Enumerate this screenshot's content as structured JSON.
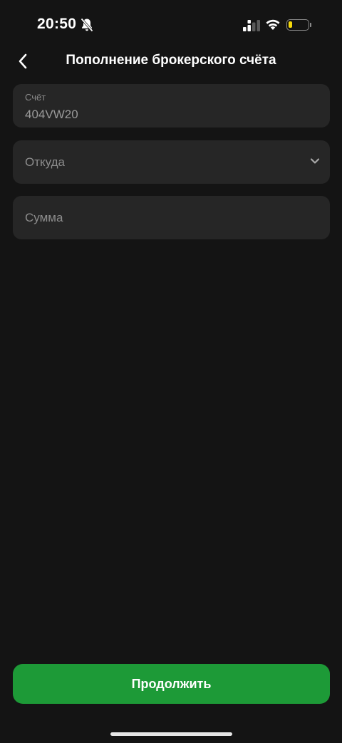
{
  "status_bar": {
    "time": "20:50",
    "icons": [
      "bell-slash-icon",
      "cellular-signal-icon",
      "wifi-icon",
      "battery-icon"
    ],
    "battery_level": 0.2,
    "battery_color": "#f5d90a"
  },
  "header": {
    "back_icon": "chevron-left-icon",
    "title": "Пополнение брокерского счёта"
  },
  "form": {
    "account": {
      "label": "Счёт",
      "value": "404VW20"
    },
    "from": {
      "placeholder": "Откуда",
      "icon": "chevron-down-icon"
    },
    "amount": {
      "placeholder": "Сумма",
      "value": ""
    }
  },
  "actions": {
    "continue_label": "Продолжить",
    "accent_color": "#1d9a37"
  },
  "colors": {
    "background": "#141414",
    "field_background": "#262626"
  }
}
